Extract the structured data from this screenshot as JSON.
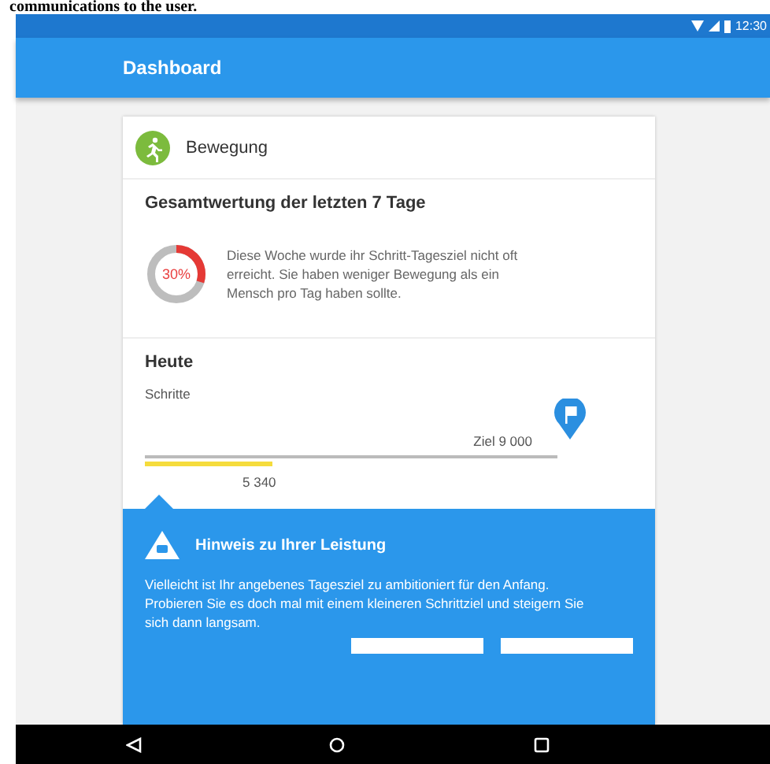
{
  "caption_fragment": "communications to the user.",
  "status_bar": {
    "time": "12:30"
  },
  "app_bar": {
    "title": "Dashboard"
  },
  "card": {
    "title": "Bewegung",
    "summary": {
      "heading": "Gesamtwertung der letzten 7 Tage",
      "percent": "30%",
      "level": 0.3,
      "text": "Diese Woche wurde ihr Schritt-Tagesziel nicht oft erreicht. Sie haben weniger Bewegung als ein Mensch pro Tag haben sollte."
    },
    "today": {
      "heading": "Heute",
      "metric": "Schritte",
      "goal": "Ziel 9 000",
      "value": "5 340",
      "level": 0.31
    },
    "hint": {
      "title": "Hinweis zu Ihrer Leistung",
      "text": "Vielleicht ist Ihr angebenes Tagesziel zu ambitioniert für den Anfang. Probieren Sie es doch mal mit einem kleineren Schrittziel und steigern Sie sich dann langsam."
    }
  }
}
